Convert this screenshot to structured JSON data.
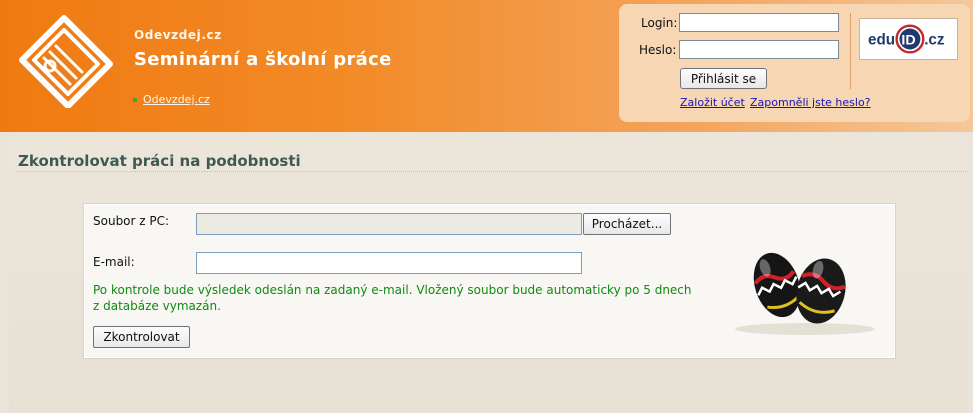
{
  "header": {
    "site_name": "Odevzdej.cz",
    "tagline": "Seminární a školní práce",
    "breadcrumb": "Odevzdej.cz"
  },
  "login": {
    "login_label": "Login:",
    "password_label": "Heslo:",
    "login_value": "",
    "password_value": "",
    "submit_label": "Přihlásit se",
    "register_link": "Založit účet",
    "forgot_link": "Zapomněli jste heslo?",
    "partner_logo": "eduID.cz"
  },
  "main": {
    "title": "Zkontrolovat práci na podobnosti",
    "file_label": "Soubor z PC:",
    "browse_label": "Procházet...",
    "email_label": "E-mail:",
    "email_value": "",
    "note": "Po kontrole bude výsledek odeslán na zadaný e-mail. Vložený soubor bude automaticky po 5 dnech z databáze vymazán.",
    "submit_label": "Zkontrolovat"
  },
  "colors": {
    "header_orange": "#f07a12",
    "login_panel": "#f6d6b3",
    "title_text": "#3e5a54",
    "note_green": "#118a11",
    "link_blue": "#1a12b4"
  },
  "icons": {
    "logo": "document-stack-icon",
    "decoration": "easter-eggs-icon"
  }
}
